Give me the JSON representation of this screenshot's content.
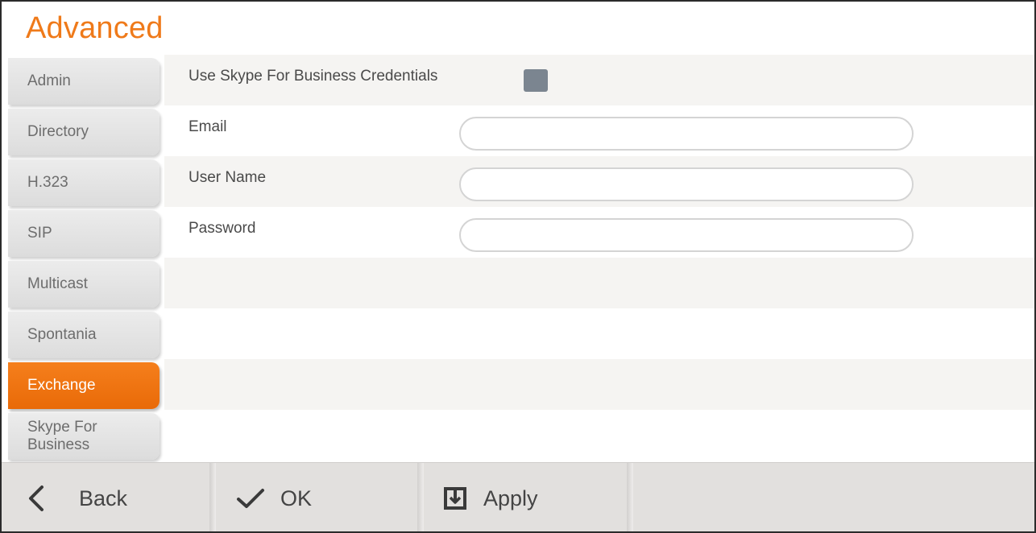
{
  "header": {
    "title": "Advanced"
  },
  "sidebar": {
    "items": [
      {
        "label": "Admin",
        "active": false
      },
      {
        "label": "Directory",
        "active": false
      },
      {
        "label": "H.323",
        "active": false
      },
      {
        "label": "SIP",
        "active": false
      },
      {
        "label": "Multicast",
        "active": false
      },
      {
        "label": "Spontania",
        "active": false
      },
      {
        "label": "Exchange",
        "active": true
      },
      {
        "label": "Skype For Business",
        "label_line1": "Skype For",
        "label_line2": "Business",
        "active": false
      }
    ]
  },
  "form": {
    "use_credentials_label": "Use Skype For Business Credentials",
    "use_credentials_checked": false,
    "email_label": "Email",
    "email_value": "",
    "username_label": "User Name",
    "username_value": "",
    "password_label": "Password",
    "password_value": ""
  },
  "bottom_bar": {
    "back_label": "Back",
    "ok_label": "OK",
    "apply_label": "Apply"
  },
  "colors": {
    "accent": "#ef7a1a",
    "checkbox": "#7b8590",
    "bar_background": "#e2e0de"
  }
}
